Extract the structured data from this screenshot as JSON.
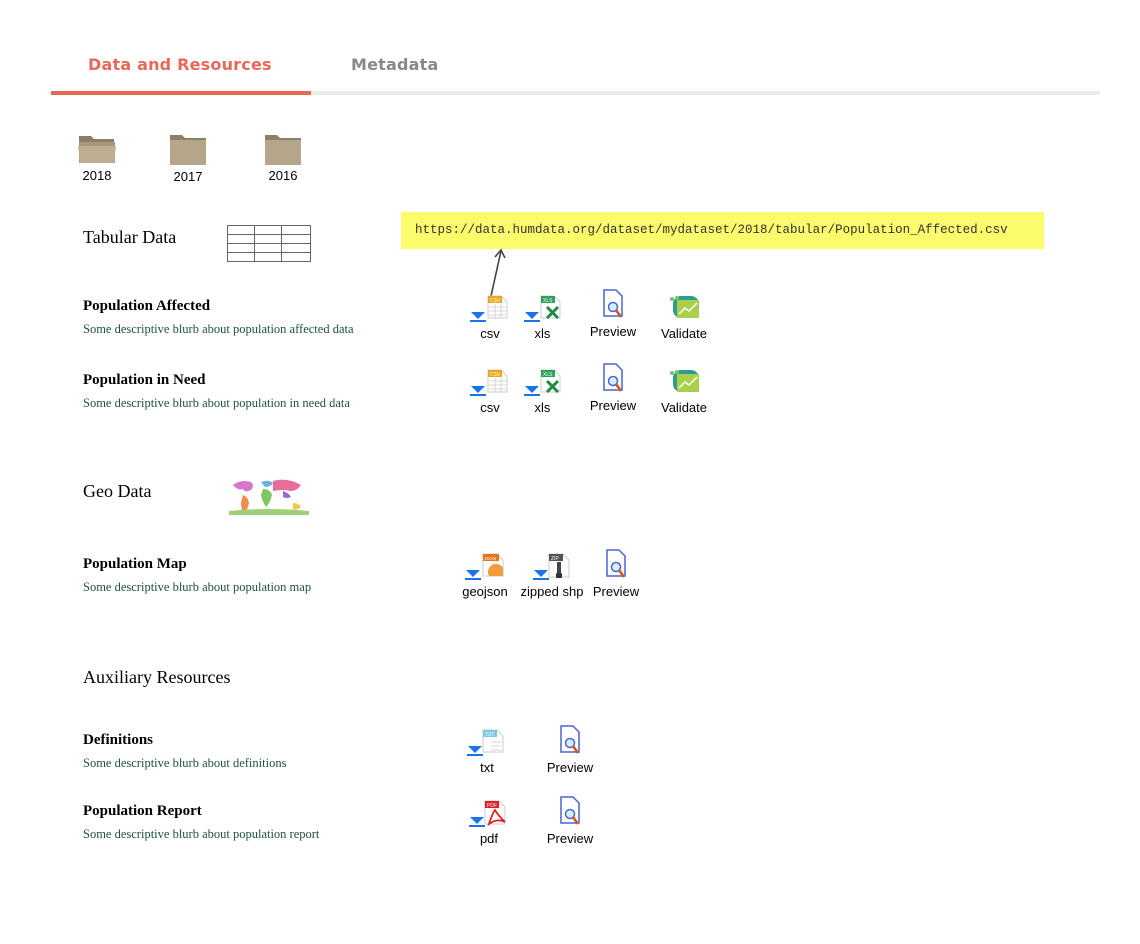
{
  "tabs": [
    {
      "label": "Data and Resources",
      "active": true
    },
    {
      "label": "Metadata",
      "active": false
    }
  ],
  "folders": [
    {
      "label": "2018",
      "state": "open"
    },
    {
      "label": "2017",
      "state": "closed"
    },
    {
      "label": "2016",
      "state": "closed"
    }
  ],
  "url_tooltip": "https://data.humdata.org/dataset/mydataset/2018/tabular/Population_Affected.csv",
  "sections": {
    "tabular": {
      "title": "Tabular Data",
      "icon": "table-icon",
      "resources": [
        {
          "name": "Population Affected",
          "desc": "Some descriptive blurb about population affected data",
          "actions": [
            "csv",
            "xls",
            "Preview",
            "Validate"
          ]
        },
        {
          "name": "Population in Need",
          "desc": "Some descriptive blurb about population in need data",
          "actions": [
            "csv",
            "xls",
            "Preview",
            "Validate"
          ]
        }
      ]
    },
    "geo": {
      "title": "Geo Data",
      "icon": "world-map-icon",
      "resources": [
        {
          "name": "Population Map",
          "desc": "Some descriptive blurb about population map",
          "actions": [
            "geojson",
            "zipped shp",
            "Preview"
          ]
        }
      ]
    },
    "aux": {
      "title": "Auxiliary Resources",
      "resources": [
        {
          "name": "Definitions",
          "desc": "Some descriptive blurb about definitions",
          "actions": [
            "txt",
            "Preview"
          ]
        },
        {
          "name": "Population Report",
          "desc": "Some descriptive blurb about population report",
          "actions": [
            "pdf",
            "Preview"
          ]
        }
      ]
    }
  },
  "icon_badges": {
    "csv": "CSV",
    "xls": "XLS",
    "json": "JSON",
    "zip": "ZIP",
    "txt": "TXT",
    "pdf": "PDF"
  },
  "colors": {
    "accent": "#e8685a",
    "tab_inactive": "#888888",
    "tooltip_bg": "#fbfc6b",
    "download_arrow": "#1a73e8",
    "folder": "#b5a58b",
    "desc_text": "#1f4f4a"
  }
}
